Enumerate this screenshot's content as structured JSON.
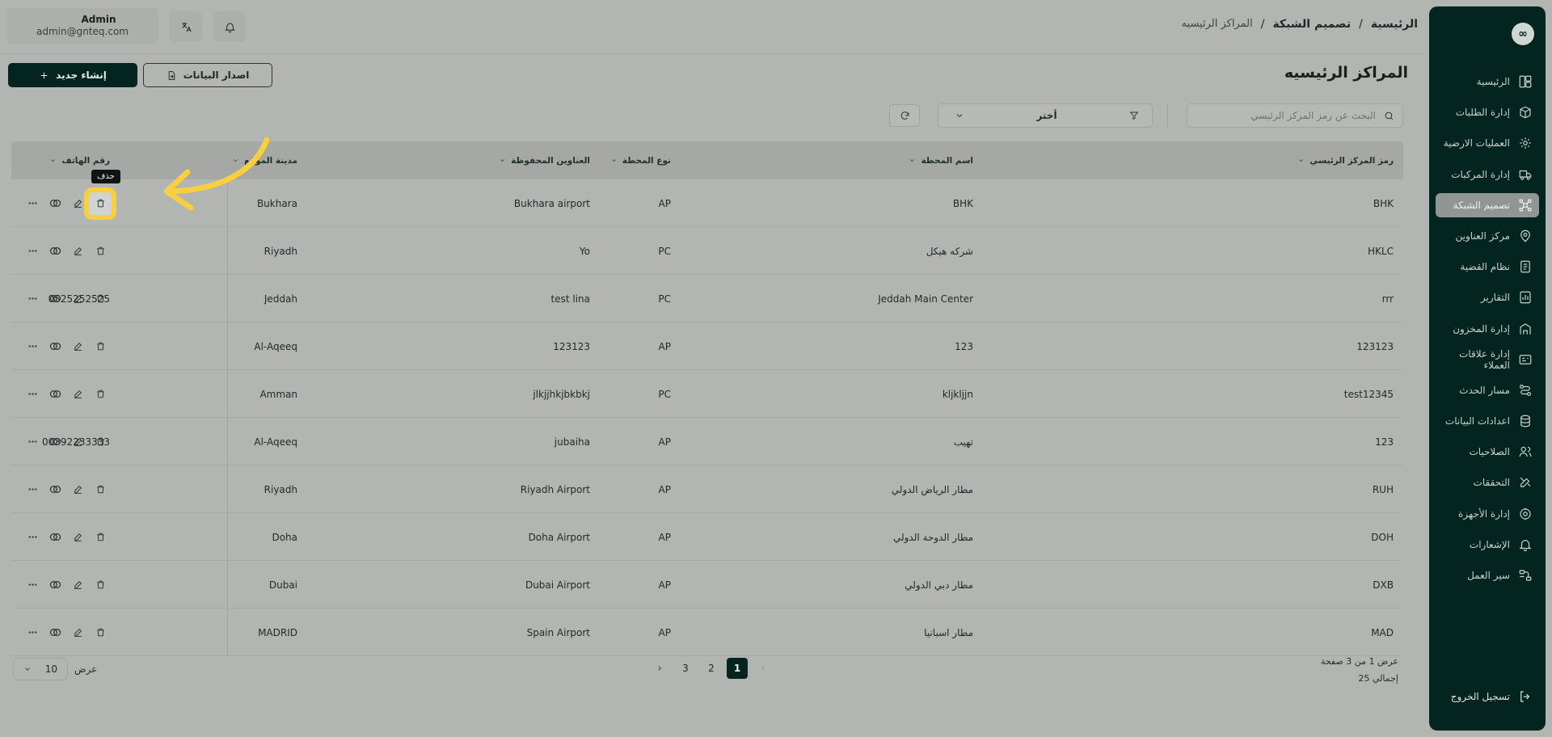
{
  "user": {
    "name": "Admin",
    "email": "admin@gnteq.com"
  },
  "breadcrumb": {
    "home": "الرئيسية",
    "section": "تصميم الشبكة",
    "current": "المراكز الرئيسيه",
    "sep": "/"
  },
  "sidebar": {
    "logo": "∞",
    "items": [
      {
        "label": "الرئيسية",
        "icon": "layout-icon"
      },
      {
        "label": "إدارة الطلبات",
        "icon": "box-icon"
      },
      {
        "label": "العمليات الارضية",
        "icon": "ground-ops-icon"
      },
      {
        "label": "إدارة المركبات",
        "icon": "truck-icon"
      },
      {
        "label": "تصميم الشبكة",
        "icon": "network-icon",
        "active": true
      },
      {
        "label": "مركز العناوين",
        "icon": "location-icon"
      },
      {
        "label": "نظام القضية",
        "icon": "case-icon"
      },
      {
        "label": "التقارير",
        "icon": "report-icon"
      },
      {
        "label": "إدارة المخزون",
        "icon": "inventory-icon"
      },
      {
        "label": "إدارة علاقات العملاء",
        "icon": "crm-icon"
      },
      {
        "label": "مسار الحدث",
        "icon": "route-icon"
      },
      {
        "label": "اعدادات البيانات",
        "icon": "database-icon"
      },
      {
        "label": "الصلاحيات",
        "icon": "users-icon"
      },
      {
        "label": "التحققات",
        "icon": "tools-icon"
      },
      {
        "label": "إدارة الأجهزة",
        "icon": "device-icon"
      },
      {
        "label": "الإشعارات",
        "icon": "bell-icon"
      },
      {
        "label": "سير العمل",
        "icon": "workflow-icon"
      }
    ],
    "logout": "تسجيل الخروج"
  },
  "page": {
    "title": "المراكز الرئيسيه",
    "create_label": "إنشاء جديد",
    "export_label": "اصدار البيانات"
  },
  "filters": {
    "search_placeholder": "البحث عن رمز المركز الرئيسي",
    "select_value": "أختر"
  },
  "table": {
    "columns": [
      "رمز المركز الرئيسي",
      "اسم المحطة",
      "نوع المحطة",
      "العناوين المحفوظة",
      "مدينة الموقع",
      "رقم الهاتف"
    ],
    "rows": [
      {
        "code": "BHK",
        "name": "BHK",
        "type": "AP",
        "address": "Bukhara airport",
        "city": "Bukhara",
        "phone": ""
      },
      {
        "code": "HKLC",
        "name": "شركه هيكل",
        "type": "PC",
        "address": "Yo",
        "city": "Riyadh",
        "phone": ""
      },
      {
        "code": "rrr",
        "name": "Jeddah Main Center",
        "type": "PC",
        "address": "test lina",
        "city": "Jeddah",
        "phone": "0525252525"
      },
      {
        "code": "123123",
        "name": "123",
        "type": "AP",
        "address": "123123",
        "city": "Al-Aqeeq",
        "phone": ""
      },
      {
        "code": "test12345",
        "name": "kljkljjn",
        "type": "PC",
        "address": "jlkjjhkjbkbkj",
        "city": "Amman",
        "phone": ""
      },
      {
        "code": "123",
        "name": "تهيب",
        "type": "AP",
        "address": "jubaiha",
        "city": "Al-Aqeeq",
        "phone": "00392233333"
      },
      {
        "code": "RUH",
        "name": "مطار الرياض الدولي",
        "type": "AP",
        "address": "Riyadh Airport",
        "city": "Riyadh",
        "phone": ""
      },
      {
        "code": "DOH",
        "name": "مطار الدوحة الدولي",
        "type": "AP",
        "address": "Doha Airport",
        "city": "Doha",
        "phone": ""
      },
      {
        "code": "DXB",
        "name": "مطار دبي الدولي",
        "type": "AP",
        "address": "Dubai Airport",
        "city": "Dubai",
        "phone": ""
      },
      {
        "code": "MAD",
        "name": "مطار اسبانيا",
        "type": "AP",
        "address": "Spain Airport",
        "city": "MADRID",
        "phone": ""
      }
    ],
    "delete_tooltip": "حذف",
    "more_label": "···"
  },
  "pagination": {
    "pages": [
      "1",
      "2",
      "3"
    ],
    "current": "1",
    "info_line1": "عرض 1 من 3 صفحة",
    "info_line2": "إجمالي 25",
    "per_page": "10",
    "per_page_label": "عرض"
  },
  "colors": {
    "sidebar_bg": "#04241f",
    "highlight": "#f7cf3f",
    "overlay_bg": "#b2b5b1"
  }
}
